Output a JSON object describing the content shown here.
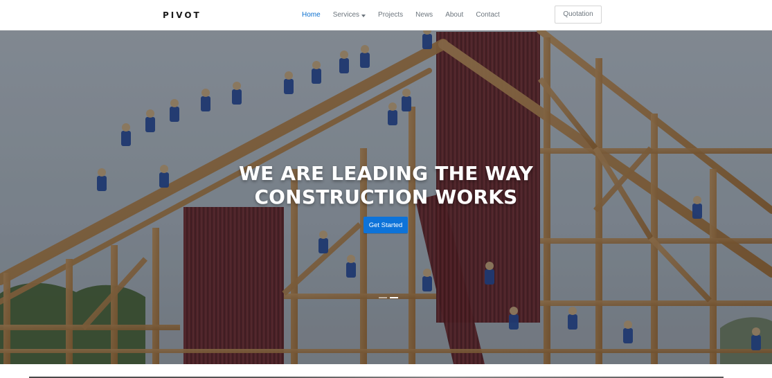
{
  "brand": {
    "name": "PIVOT"
  },
  "nav": {
    "items": [
      {
        "label": "Home"
      },
      {
        "label": "Services"
      },
      {
        "label": "Projects"
      },
      {
        "label": "News"
      },
      {
        "label": "About"
      },
      {
        "label": "Contact"
      }
    ],
    "active_index": 0,
    "quotation_label": "Quotation"
  },
  "hero": {
    "title_line_1": "WE ARE LEADING THE WAY",
    "title_line_2": "CONSTRUCTION WORKS",
    "cta_label": "Get Started",
    "slide_indicators": 2,
    "active_indicator": 1,
    "image_icon": "construction-photo"
  },
  "colors": {
    "accent": "#0a6fcf",
    "cta": "#0d73d9"
  }
}
